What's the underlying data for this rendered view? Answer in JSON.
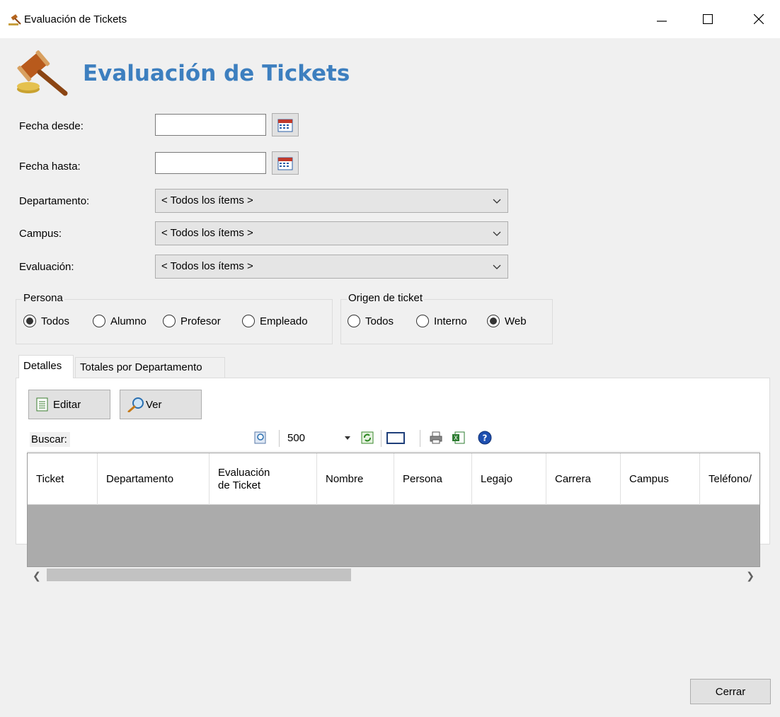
{
  "window": {
    "title": "Evaluación de Tickets"
  },
  "header": {
    "title": "Evaluación de Tickets"
  },
  "filters": {
    "fecha_desde": {
      "label": "Fecha desde:",
      "value": ""
    },
    "fecha_hasta": {
      "label": "Fecha hasta:",
      "value": ""
    },
    "departamento": {
      "label": "Departamento:",
      "value": "< Todos los ítems >"
    },
    "campus": {
      "label": "Campus:",
      "value": "< Todos los ítems >"
    },
    "evaluacion": {
      "label": "Evaluación:",
      "value": "< Todos los ítems >"
    }
  },
  "persona": {
    "legend": "Persona",
    "options": [
      "Todos",
      "Alumno",
      "Profesor",
      "Empleado"
    ],
    "selected": "Todos"
  },
  "origen": {
    "legend": "Origen de ticket",
    "options": [
      "Todos",
      "Interno",
      "Web"
    ],
    "selected": "Web"
  },
  "tabs": [
    {
      "label": "Detalles",
      "active": true
    },
    {
      "label": "Totales por Departamento",
      "active": false
    }
  ],
  "buttons": {
    "editar": "Editar",
    "ver": "Ver",
    "cerrar": "Cerrar"
  },
  "toolbar": {
    "buscar_label": "Buscar:",
    "page_size": "500",
    "icons": [
      "search-icon",
      "refresh-icon",
      "window-icon",
      "print-icon",
      "excel-export-icon",
      "help-icon"
    ]
  },
  "grid": {
    "columns": [
      "Ticket",
      "Departamento",
      "Evaluación de Ticket",
      "Nombre",
      "Persona",
      "Legajo",
      "Carrera",
      "Campus",
      "Teléfono/"
    ],
    "rows": []
  },
  "colors": {
    "title_blue": "#3d7fbf",
    "grid_empty": "#ababab",
    "window_bg": "#f0f0f0"
  }
}
